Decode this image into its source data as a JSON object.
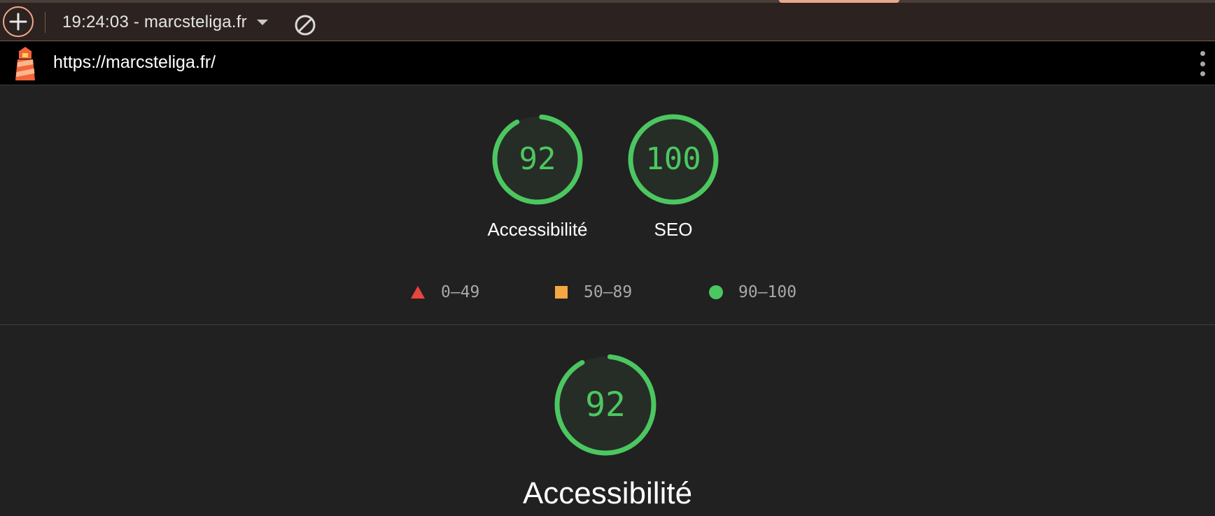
{
  "toolbar": {
    "new_report_icon": "plus-icon",
    "report_selector": "19:24:03 - marcsteliga.fr",
    "clear_icon": "no-entry-icon"
  },
  "urlbar": {
    "url": "https://marcsteliga.fr/",
    "menu_icon": "kebab-menu-icon"
  },
  "summary": {
    "gauges": [
      {
        "score": "92",
        "value": 92,
        "label": "Accessibilité"
      },
      {
        "score": "100",
        "value": 100,
        "label": "SEO"
      }
    ],
    "legend": [
      {
        "range": "0–49",
        "shape": "triangle",
        "color": "#e8453c"
      },
      {
        "range": "50–89",
        "shape": "square",
        "color": "#f4a742"
      },
      {
        "range": "90–100",
        "shape": "circle",
        "color": "#4cc760"
      }
    ]
  },
  "category": {
    "score": "92",
    "value": 92,
    "title": "Accessibilité"
  },
  "colors": {
    "pass": "#4cc760",
    "gauge_fill": "#262d27",
    "accent": "#f0a88a"
  }
}
